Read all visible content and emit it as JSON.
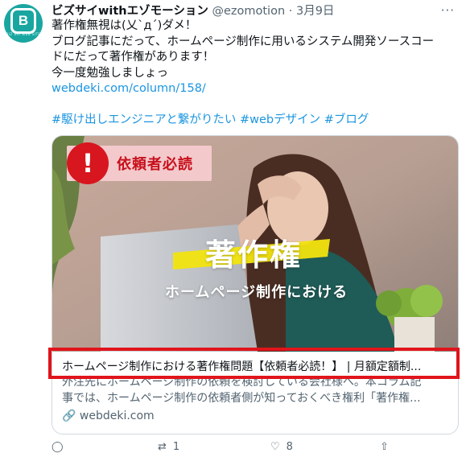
{
  "tweet": {
    "author_name": "ビズサイwithエゾモーション",
    "handle": "@ezomotion",
    "separator": "·",
    "date": "3月9日",
    "more_label": "···",
    "avatar_letter": "B",
    "avatar_caption": "BIZ SAI WEB SITE",
    "lines": [
      "著作権無視は(乂`д´)ダメ！",
      "ブログ記事にだって、ホームページ制作に用いるシステム開発ソースコー",
      "ドにだって著作権があります！",
      "今一度勉強しましょっ"
    ],
    "link": "webdeki.com/column/158/",
    "hashtags": "#駆け出しエンジニアと繋がりたい #webデザイン #ブログ"
  },
  "card": {
    "badge_text": "依頼者必読",
    "hero_title": "著作権",
    "hero_subtitle": "ホームページ制作における",
    "title": "ホームページ制作における著作権問題【依頼者必読！】 | 月額定額制...",
    "desc_lines": [
      "外注先にホームページ制作の依頼を検討している会社様へ。本コラム記",
      "事では、ホームページ制作の依頼者側が知っておくべき権利「著作権..."
    ],
    "domain": "webdeki.com"
  },
  "actions": {
    "reply_count": "",
    "retweet_count": "1",
    "like_count": "8"
  },
  "colors": {
    "link": "#1b95e0",
    "highlight": "#e1141b",
    "avatar": "#1aa6a0",
    "badge_red": "#d7161f"
  }
}
